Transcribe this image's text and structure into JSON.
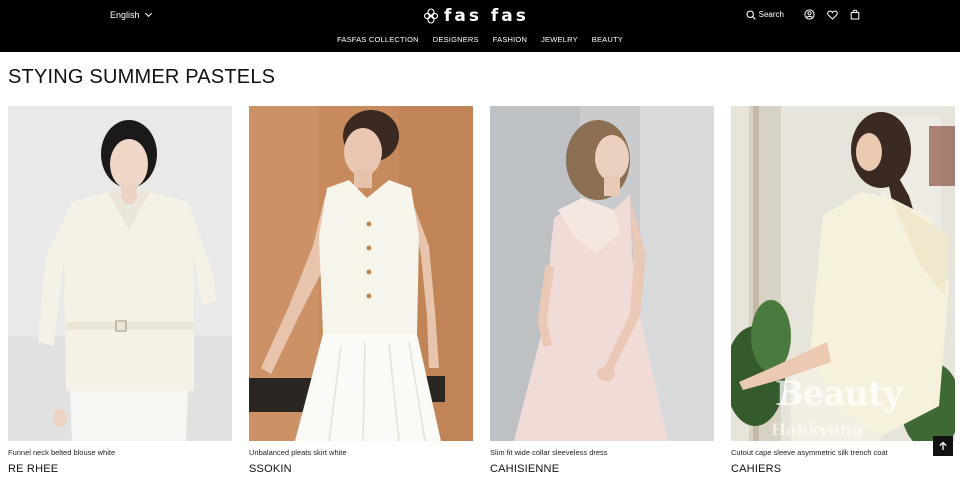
{
  "header": {
    "language": "English",
    "brand": "fas fas",
    "search_label": "Search",
    "icons": [
      "search-icon",
      "user-icon",
      "heart-icon",
      "bag-icon",
      "chevron-down-icon"
    ]
  },
  "nav": {
    "items": [
      {
        "label": "FASFAS COLLECTION"
      },
      {
        "label": "DESIGNERS"
      },
      {
        "label": "FASHION"
      },
      {
        "label": "JEWELRY"
      },
      {
        "label": "BEAUTY"
      }
    ]
  },
  "section": {
    "title": "STYING SUMMER PASTELS"
  },
  "products": [
    {
      "name": "Funnel neck belted blouse white",
      "brand": "RE RHEE"
    },
    {
      "name": "Unbalanced pleats skirt white",
      "brand": "SSOKIN"
    },
    {
      "name": "Slim fit wide collar sleeveless dress",
      "brand": "CAHISIENNE"
    },
    {
      "name": "Cutout cape sleeve asymmetric silk trench coat",
      "brand": "CAHIERS"
    }
  ],
  "watermark": {
    "text": "Beauty",
    "subtext": "Hankyung"
  },
  "colors": {
    "topbar": "#000000",
    "text": "#111111"
  }
}
